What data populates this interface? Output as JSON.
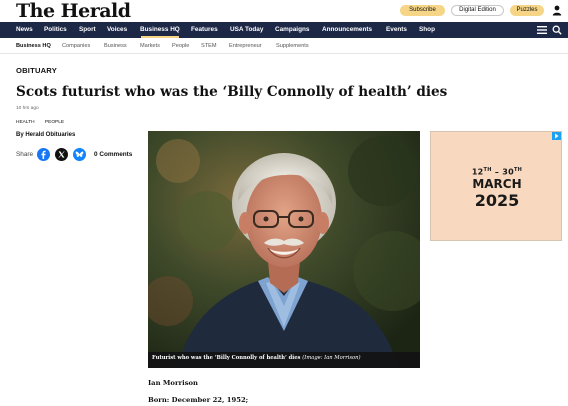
{
  "header": {
    "logo_text": "The Herald",
    "subscribe_label": "Subscribe",
    "digital_edition_label": "Digital Edition",
    "puzzles_label": "Puzzles"
  },
  "main_nav": {
    "items": [
      "News",
      "Politics",
      "Sport",
      "Voices",
      "Business HQ",
      "Features",
      "USA Today",
      "Campaigns",
      "Announcements",
      "Events",
      "Shop"
    ],
    "active": "Business HQ"
  },
  "sub_nav": {
    "items": [
      "Business HQ",
      "Companies",
      "Business",
      "Markets",
      "People",
      "STEM",
      "Entrepreneur",
      "Supplements"
    ],
    "current": "Business HQ"
  },
  "article": {
    "kicker": "OBITUARY",
    "headline": "Scots futurist who was the ‘Billy Connolly of health’ dies",
    "timestamp": "10 hrs ago",
    "tags": [
      "HEALTH",
      "PEOPLE"
    ],
    "byline": "By Herald Obituaries",
    "share_label": "Share",
    "comments_label": "0 Comments",
    "caption_text": "Futurist who was the ‘Billy Connolly of health’ dies",
    "caption_credit": "(Image: Ian Morrison)",
    "body": [
      "Ian Morrison",
      "Born: December 22, 1952;"
    ]
  },
  "ad": {
    "line1_day_start": "12",
    "line1_suffix_start": "TH",
    "line1_sep": " – ",
    "line1_day_end": "30",
    "line1_suffix_end": "TH",
    "line2": "MARCH",
    "line3": "2025"
  },
  "colors": {
    "nav_bg": "#1d2847",
    "accent": "#f6d587",
    "ad_bg": "#f8d9bf",
    "facebook": "#1877f2",
    "bluesky": "#1185fe"
  }
}
